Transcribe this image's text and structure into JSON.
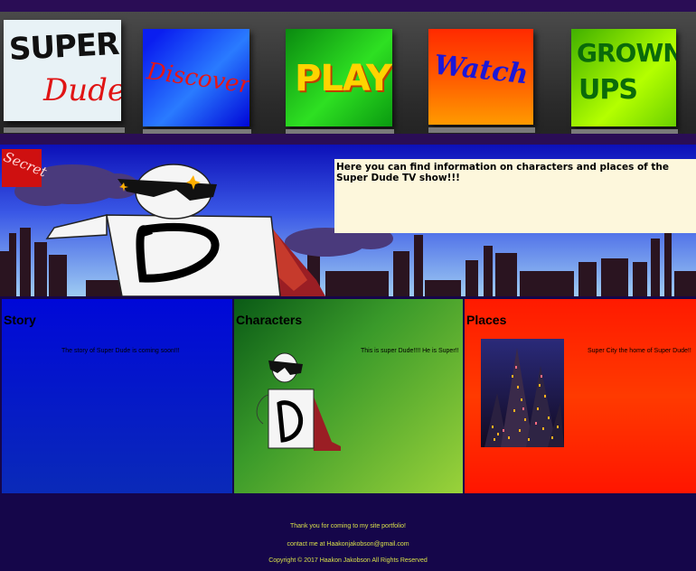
{
  "nav": {
    "items": [
      {
        "line1": "SUPER",
        "line2": "Dude"
      },
      {
        "label": "Discover"
      },
      {
        "label": "PLAY"
      },
      {
        "label": "Watch"
      },
      {
        "line1": "GROWN",
        "line2": "UPS"
      }
    ]
  },
  "hero": {
    "secret_label": "Secret",
    "info_text": "Here you can find information on characters and places of the Super Dude TV show!!!"
  },
  "panels": [
    {
      "title": "Story",
      "text": "The story of Super Dude is coming soon!!!"
    },
    {
      "title": "Characters",
      "text": "This is super Dude!!!! He is Super!!"
    },
    {
      "title": "Places",
      "text": "Super City the home of Super Dude!!"
    }
  ],
  "footer": {
    "line1": "Thank you for coming to my site portfolio!",
    "line2": "contact me at Haakonjakobson@gmail.com",
    "line3": "Copyright © 2017 Haakon Jakobson All Rights Reserved"
  },
  "colors": {
    "background": "#15064a",
    "discover": "#1b3cff",
    "play": "#18b010",
    "watch": "#ff3a00",
    "grown_ups": "#7ee000",
    "footer_text": "#d8e04a"
  }
}
